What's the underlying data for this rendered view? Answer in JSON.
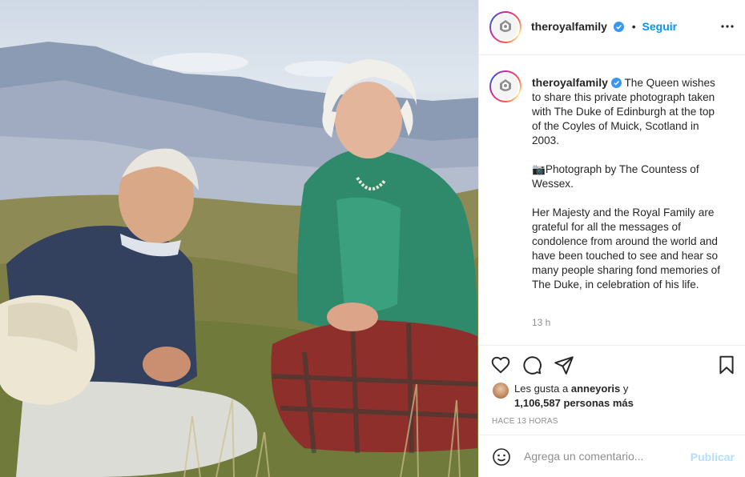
{
  "account": {
    "username": "theroyalfamily",
    "verified": true,
    "separator": "•",
    "follow_label": "Seguir"
  },
  "post": {
    "caption": "The Queen wishes to share this private photograph taken with The Duke of Edinburgh at the top of the Coyles of Muick, Scotland in 2003.\n\n📷Photograph by The Countess of Wessex.\n\nHer Majesty and the Royal Family are grateful for all the messages of condolence from around the world and have been touched to see and hear so many people sharing fond memories of The Duke, in celebration of his life.",
    "caption_time": "13 h"
  },
  "engagement": {
    "likes_prefix": "Les gusta a",
    "liked_by_user": "anneyoris",
    "likes_joiner": "y",
    "likes_count": "1,106,587 personas más",
    "posted_ago": "HACE 13 HORAS"
  },
  "comment": {
    "placeholder": "Agrega un comentario...",
    "publish_label": "Publicar"
  },
  "icons": {
    "like": "heart-icon",
    "comment": "comment-icon",
    "share": "paper-plane-icon",
    "save": "bookmark-icon",
    "more": "more-options-icon",
    "emoji": "emoji-icon",
    "verified": "verified-badge-icon"
  },
  "colors": {
    "accent": "#0095f6",
    "muted": "#8e8e8e",
    "border": "#efefef",
    "publish_disabled": "#b2dffc"
  }
}
